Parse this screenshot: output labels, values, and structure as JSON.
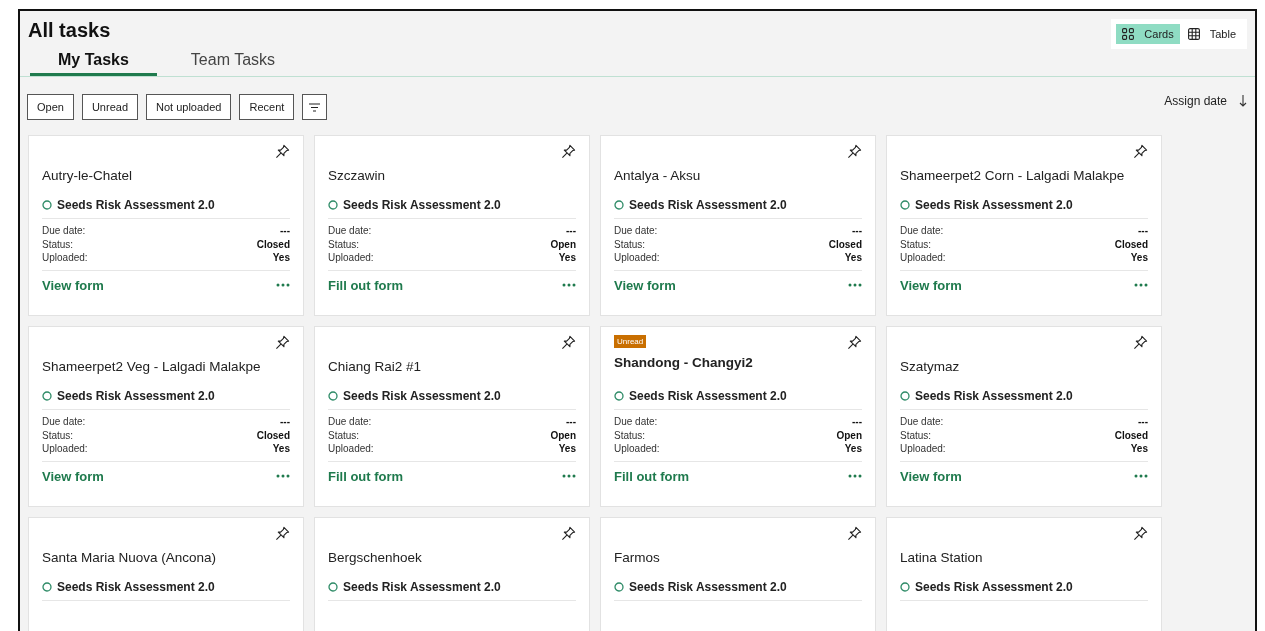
{
  "title": "All tasks",
  "view_toggle": [
    {
      "label": "Cards",
      "kind": "cards",
      "selected": true
    },
    {
      "label": "Table",
      "kind": "table",
      "selected": false
    }
  ],
  "tabs": [
    {
      "label": "My Tasks",
      "selected": true
    },
    {
      "label": "Team Tasks",
      "selected": false
    }
  ],
  "filters": [
    "Open",
    "Unread",
    "Not uploaded",
    "Recent"
  ],
  "sort": {
    "label": "Assign date"
  },
  "cards": [
    {
      "title": "Autry-le-Chatel",
      "unread": false,
      "form": "Seeds Risk Assessment 2.0",
      "details": [
        {
          "label": "Due date:",
          "value": "---"
        },
        {
          "label": "Status:",
          "value": "Closed"
        },
        {
          "label": "Uploaded:",
          "value": "Yes"
        }
      ],
      "action": "View form"
    },
    {
      "title": "Szczawin",
      "unread": false,
      "form": "Seeds Risk Assessment 2.0",
      "details": [
        {
          "label": "Due date:",
          "value": "---"
        },
        {
          "label": "Status:",
          "value": "Open"
        },
        {
          "label": "Uploaded:",
          "value": "Yes"
        }
      ],
      "action": "Fill out form"
    },
    {
      "title": "Antalya - Aksu",
      "unread": false,
      "form": "Seeds Risk Assessment 2.0",
      "details": [
        {
          "label": "Due date:",
          "value": "---"
        },
        {
          "label": "Status:",
          "value": "Closed"
        },
        {
          "label": "Uploaded:",
          "value": "Yes"
        }
      ],
      "action": "View form"
    },
    {
      "title": "Shameerpet2 Corn - Lalgadi Malakpe",
      "unread": false,
      "form": "Seeds Risk Assessment 2.0",
      "details": [
        {
          "label": "Due date:",
          "value": "---"
        },
        {
          "label": "Status:",
          "value": "Closed"
        },
        {
          "label": "Uploaded:",
          "value": "Yes"
        }
      ],
      "action": "View form"
    },
    {
      "title": "Shameerpet2 Veg - Lalgadi Malakpe",
      "unread": false,
      "form": "Seeds Risk Assessment 2.0",
      "details": [
        {
          "label": "Due date:",
          "value": "---"
        },
        {
          "label": "Status:",
          "value": "Closed"
        },
        {
          "label": "Uploaded:",
          "value": "Yes"
        }
      ],
      "action": "View form"
    },
    {
      "title": "Chiang Rai2 #1",
      "unread": false,
      "form": "Seeds Risk Assessment 2.0",
      "details": [
        {
          "label": "Due date:",
          "value": "---"
        },
        {
          "label": "Status:",
          "value": "Open"
        },
        {
          "label": "Uploaded:",
          "value": "Yes"
        }
      ],
      "action": "Fill out form"
    },
    {
      "title": "Shandong - Changyi2",
      "unread": true,
      "badge": "Unread",
      "form": "Seeds Risk Assessment 2.0",
      "details": [
        {
          "label": "Due date:",
          "value": "---"
        },
        {
          "label": "Status:",
          "value": "Open"
        },
        {
          "label": "Uploaded:",
          "value": "Yes"
        }
      ],
      "action": "Fill out form"
    },
    {
      "title": "Szatymaz",
      "unread": false,
      "form": "Seeds Risk Assessment 2.0",
      "details": [
        {
          "label": "Due date:",
          "value": "---"
        },
        {
          "label": "Status:",
          "value": "Closed"
        },
        {
          "label": "Uploaded:",
          "value": "Yes"
        }
      ],
      "action": "View form"
    },
    {
      "title": "Santa Maria Nuova (Ancona)",
      "unread": false,
      "form": "Seeds Risk Assessment 2.0"
    },
    {
      "title": "Bergschenhoek",
      "unread": false,
      "form": "Seeds Risk Assessment 2.0"
    },
    {
      "title": "Farmos",
      "unread": false,
      "form": "Seeds Risk Assessment 2.0"
    },
    {
      "title": "Latina Station",
      "unread": false,
      "form": "Seeds Risk Assessment 2.0"
    }
  ]
}
